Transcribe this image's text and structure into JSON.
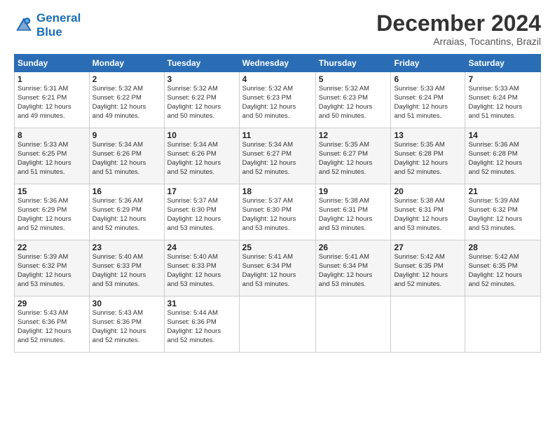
{
  "logo": {
    "line1": "General",
    "line2": "Blue"
  },
  "title": "December 2024",
  "subtitle": "Arraias, Tocantins, Brazil",
  "days_of_week": [
    "Sunday",
    "Monday",
    "Tuesday",
    "Wednesday",
    "Thursday",
    "Friday",
    "Saturday"
  ],
  "weeks": [
    [
      {
        "day": "1",
        "info": "Sunrise: 5:31 AM\nSunset: 6:21 PM\nDaylight: 12 hours\nand 49 minutes."
      },
      {
        "day": "2",
        "info": "Sunrise: 5:32 AM\nSunset: 6:22 PM\nDaylight: 12 hours\nand 49 minutes."
      },
      {
        "day": "3",
        "info": "Sunrise: 5:32 AM\nSunset: 6:22 PM\nDaylight: 12 hours\nand 50 minutes."
      },
      {
        "day": "4",
        "info": "Sunrise: 5:32 AM\nSunset: 6:23 PM\nDaylight: 12 hours\nand 50 minutes."
      },
      {
        "day": "5",
        "info": "Sunrise: 5:32 AM\nSunset: 6:23 PM\nDaylight: 12 hours\nand 50 minutes."
      },
      {
        "day": "6",
        "info": "Sunrise: 5:33 AM\nSunset: 6:24 PM\nDaylight: 12 hours\nand 51 minutes."
      },
      {
        "day": "7",
        "info": "Sunrise: 5:33 AM\nSunset: 6:24 PM\nDaylight: 12 hours\nand 51 minutes."
      }
    ],
    [
      {
        "day": "8",
        "info": "Sunrise: 5:33 AM\nSunset: 6:25 PM\nDaylight: 12 hours\nand 51 minutes."
      },
      {
        "day": "9",
        "info": "Sunrise: 5:34 AM\nSunset: 6:26 PM\nDaylight: 12 hours\nand 51 minutes."
      },
      {
        "day": "10",
        "info": "Sunrise: 5:34 AM\nSunset: 6:26 PM\nDaylight: 12 hours\nand 52 minutes."
      },
      {
        "day": "11",
        "info": "Sunrise: 5:34 AM\nSunset: 6:27 PM\nDaylight: 12 hours\nand 52 minutes."
      },
      {
        "day": "12",
        "info": "Sunrise: 5:35 AM\nSunset: 6:27 PM\nDaylight: 12 hours\nand 52 minutes."
      },
      {
        "day": "13",
        "info": "Sunrise: 5:35 AM\nSunset: 6:28 PM\nDaylight: 12 hours\nand 52 minutes."
      },
      {
        "day": "14",
        "info": "Sunrise: 5:36 AM\nSunset: 6:28 PM\nDaylight: 12 hours\nand 52 minutes."
      }
    ],
    [
      {
        "day": "15",
        "info": "Sunrise: 5:36 AM\nSunset: 6:29 PM\nDaylight: 12 hours\nand 52 minutes."
      },
      {
        "day": "16",
        "info": "Sunrise: 5:36 AM\nSunset: 6:29 PM\nDaylight: 12 hours\nand 52 minutes."
      },
      {
        "day": "17",
        "info": "Sunrise: 5:37 AM\nSunset: 6:30 PM\nDaylight: 12 hours\nand 53 minutes."
      },
      {
        "day": "18",
        "info": "Sunrise: 5:37 AM\nSunset: 6:30 PM\nDaylight: 12 hours\nand 53 minutes."
      },
      {
        "day": "19",
        "info": "Sunrise: 5:38 AM\nSunset: 6:31 PM\nDaylight: 12 hours\nand 53 minutes."
      },
      {
        "day": "20",
        "info": "Sunrise: 5:38 AM\nSunset: 6:31 PM\nDaylight: 12 hours\nand 53 minutes."
      },
      {
        "day": "21",
        "info": "Sunrise: 5:39 AM\nSunset: 6:32 PM\nDaylight: 12 hours\nand 53 minutes."
      }
    ],
    [
      {
        "day": "22",
        "info": "Sunrise: 5:39 AM\nSunset: 6:32 PM\nDaylight: 12 hours\nand 53 minutes."
      },
      {
        "day": "23",
        "info": "Sunrise: 5:40 AM\nSunset: 6:33 PM\nDaylight: 12 hours\nand 53 minutes."
      },
      {
        "day": "24",
        "info": "Sunrise: 5:40 AM\nSunset: 6:33 PM\nDaylight: 12 hours\nand 53 minutes."
      },
      {
        "day": "25",
        "info": "Sunrise: 5:41 AM\nSunset: 6:34 PM\nDaylight: 12 hours\nand 53 minutes."
      },
      {
        "day": "26",
        "info": "Sunrise: 5:41 AM\nSunset: 6:34 PM\nDaylight: 12 hours\nand 53 minutes."
      },
      {
        "day": "27",
        "info": "Sunrise: 5:42 AM\nSunset: 6:35 PM\nDaylight: 12 hours\nand 52 minutes."
      },
      {
        "day": "28",
        "info": "Sunrise: 5:42 AM\nSunset: 6:35 PM\nDaylight: 12 hours\nand 52 minutes."
      }
    ],
    [
      {
        "day": "29",
        "info": "Sunrise: 5:43 AM\nSunset: 6:36 PM\nDaylight: 12 hours\nand 52 minutes."
      },
      {
        "day": "30",
        "info": "Sunrise: 5:43 AM\nSunset: 6:36 PM\nDaylight: 12 hours\nand 52 minutes."
      },
      {
        "day": "31",
        "info": "Sunrise: 5:44 AM\nSunset: 6:36 PM\nDaylight: 12 hours\nand 52 minutes."
      },
      null,
      null,
      null,
      null
    ]
  ]
}
